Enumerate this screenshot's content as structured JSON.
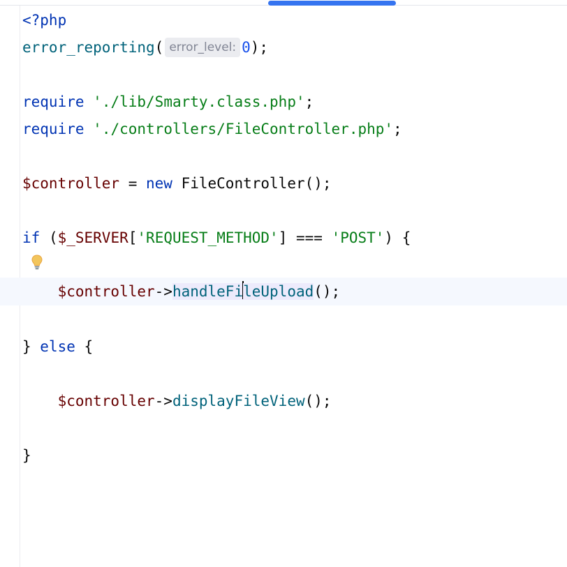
{
  "editor": {
    "lines": {
      "l1": {
        "open_tag": "<?php"
      },
      "l2": {
        "fn": "error_reporting",
        "paren_open": "(",
        "hint": "error_level:",
        "num": "0",
        "tail": ");"
      },
      "l4": {
        "kw": "require",
        "space": " ",
        "str": "'./lib/Smarty.class.php'",
        "semi": ";"
      },
      "l5": {
        "kw": "require",
        "space": " ",
        "str": "'./controllers/FileController.php'",
        "semi": ";"
      },
      "l7": {
        "var": "$controller",
        "eq": " = ",
        "kw": "new",
        "rest": " FileController();"
      },
      "l9": {
        "kw": "if",
        "open": " (",
        "var": "$_SERVER",
        "br1": "[",
        "str1": "'REQUEST_METHOD'",
        "op": "] === ",
        "str2": "'POST'",
        "close": ") {"
      },
      "l11": {
        "indent": "    ",
        "var": "$controller",
        "arrow": "->",
        "method_a": "handleFi",
        "method_b": "leUpload",
        "tail": "();"
      },
      "l13": {
        "brace": "} ",
        "kw": "else",
        "rest": " {"
      },
      "l15": {
        "indent": "    ",
        "var": "$controller",
        "arrow": "->",
        "method": "displayFileView",
        "tail": "();"
      },
      "l17": {
        "brace": "}"
      }
    },
    "intention_icon": "lightbulb-icon"
  }
}
